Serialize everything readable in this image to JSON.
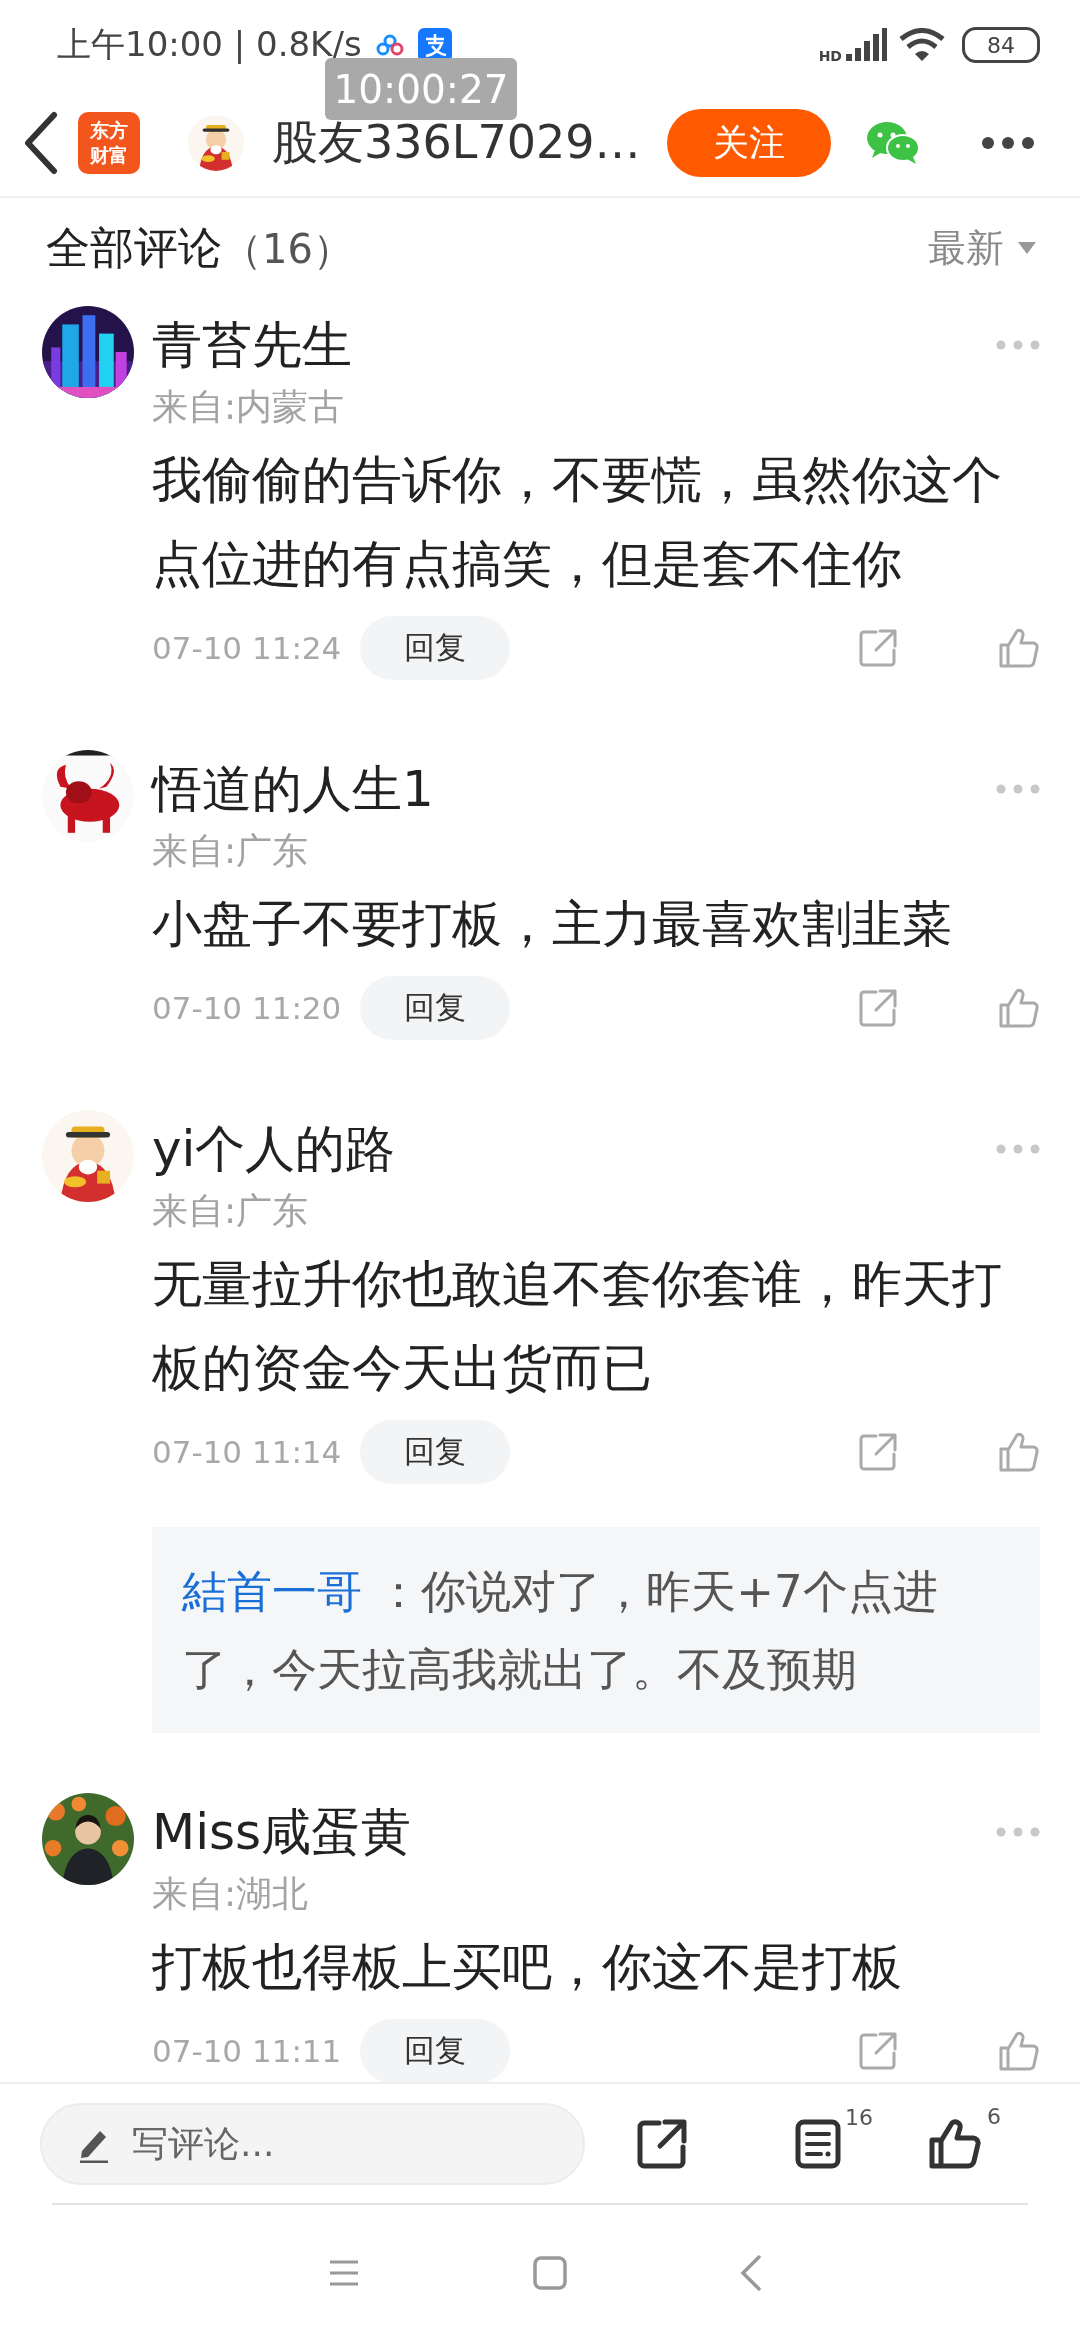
{
  "status_bar": {
    "time": "上午10:00 | 0.8K/s",
    "network": "HD",
    "battery": "84"
  },
  "recording_time": "10:00:27",
  "nav": {
    "logo_lines": [
      "东方",
      "财富"
    ],
    "title": "股友336L7029…",
    "follow": "关注"
  },
  "comments_header": {
    "title": "全部评论",
    "count": "（16）",
    "sort": "最新"
  },
  "comments": [
    {
      "name": "青苔先生",
      "location": "来自:内蒙古",
      "text": "我偷偷的告诉你，不要慌，虽然你这个点位进的有点搞笑，但是套不住你",
      "time": "07-10 11:24",
      "reply": "回复"
    },
    {
      "name": "悟道的人生1",
      "location": "来自:广东",
      "text": "小盘子不要打板，主力最喜欢割韭菜",
      "time": "07-10 11:20",
      "reply": "回复"
    },
    {
      "name": "yi个人的路",
      "location": "来自:广东",
      "text": "无量拉升你也敢追不套你套谁，昨天打板的资金今天出货而已",
      "time": "07-10 11:14",
      "reply": "回复",
      "replies": [
        {
          "author": "結首一哥",
          "text": "：你说对了，昨天+7个点进了，今天拉高我就出了。不及预期"
        }
      ]
    },
    {
      "name": "Miss咸蛋黄",
      "location": "来自:湖北",
      "text": "打板也得板上买吧，你这不是打板",
      "time": "07-10 11:11",
      "reply": "回复"
    }
  ],
  "bottom_bar": {
    "placeholder": "写评论...",
    "comment_count": "16",
    "like_count": "6"
  }
}
